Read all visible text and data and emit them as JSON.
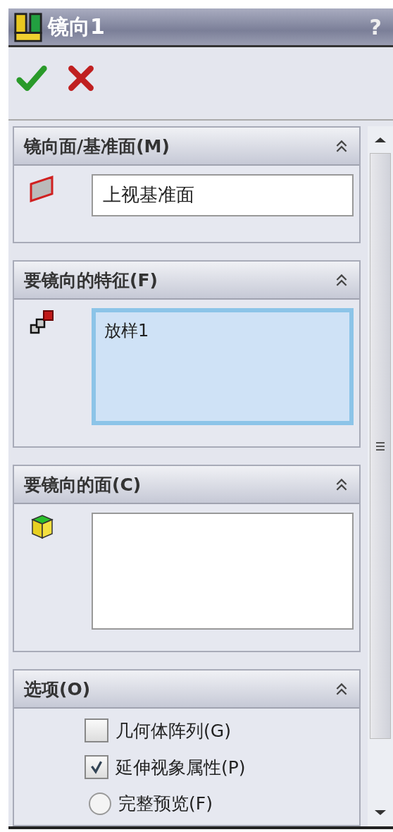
{
  "window": {
    "title": "镜向1",
    "help": "?"
  },
  "sections": [
    {
      "kind": "field",
      "title": "镜向面/基准面(M)",
      "expanded": true,
      "value": "上视基准面",
      "selected": false
    },
    {
      "kind": "list",
      "title": "要镜向的特征(F)",
      "expanded": true,
      "items": [
        "放样1"
      ],
      "selected": true
    },
    {
      "kind": "list",
      "title": "要镜向的面(C)",
      "expanded": true,
      "selected": false
    },
    {
      "kind": "options",
      "title": "选项(O)",
      "expanded": true,
      "options": [
        {
          "kind": "checkbox",
          "label": "几何体阵列(G)",
          "checked": false
        },
        {
          "kind": "checkbox",
          "label": "延伸视象属性(P)",
          "checked": true
        },
        {
          "kind": "radio",
          "label": "完整预览(F)",
          "checked": false
        }
      ]
    }
  ]
}
